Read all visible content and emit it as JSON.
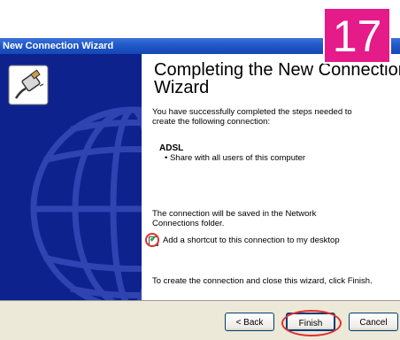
{
  "window": {
    "title": "New Connection Wizard"
  },
  "badge": {
    "number": "17",
    "color": "#e51b8a"
  },
  "content": {
    "heading_line1": "Completing the New Connection",
    "heading_line2": "Wizard",
    "intro_line1": "You have successfully completed the steps needed to",
    "intro_line2": "create the following connection:",
    "connection_name": "ADSL",
    "connection_detail": "• Share with all users of this computer",
    "save_note_line1": "The connection will be saved in the Network",
    "save_note_line2": "Connections folder.",
    "shortcut_checkbox_label": "Add a shortcut to this connection to my desktop",
    "shortcut_checked": true,
    "finish_instruction": "To create the connection and close this wizard, click Finish."
  },
  "buttons": {
    "back": "< Back",
    "finish": "Finish",
    "cancel": "Cancel"
  },
  "icons": {
    "wizard_icon": "network-cable-icon",
    "side_graphic": "globe-graphic"
  },
  "colors": {
    "side_panel": "#0d228c",
    "title_bar": "#1f58c8",
    "highlight": "#e0302e"
  }
}
